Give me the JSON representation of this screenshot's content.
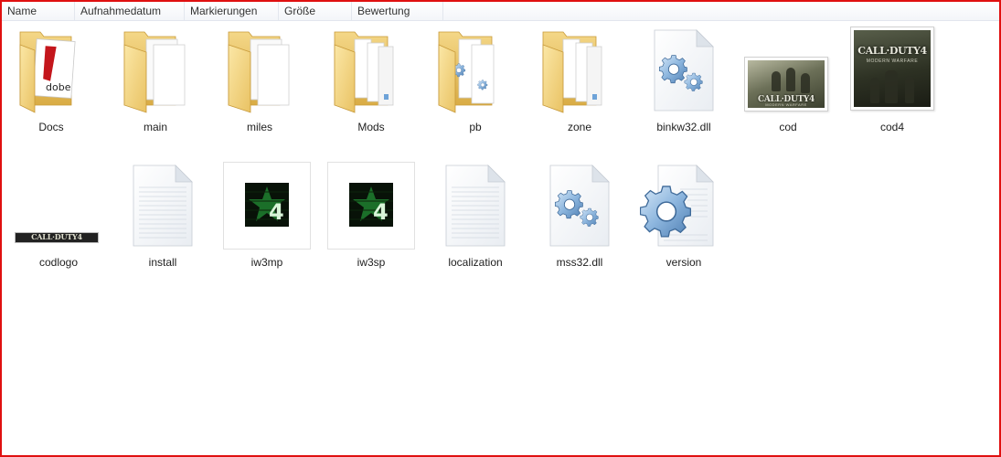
{
  "columns": {
    "name": "Name",
    "date": "Aufnahmedatum",
    "tags": "Markierungen",
    "size": "Größe",
    "rating": "Bewertung"
  },
  "items": {
    "docs": {
      "label": "Docs",
      "icon": "folder-pdf-icon"
    },
    "main": {
      "label": "main",
      "icon": "folder-documents-icon"
    },
    "miles": {
      "label": "miles",
      "icon": "folder-documents-icon"
    },
    "mods": {
      "label": "Mods",
      "icon": "folder-files-icon"
    },
    "pb": {
      "label": "pb",
      "icon": "folder-gear-icon"
    },
    "zone": {
      "label": "zone",
      "icon": "folder-files-icon"
    },
    "binkw32": {
      "label": "binkw32.dll",
      "icon": "dll-file-icon"
    },
    "cod": {
      "label": "cod",
      "icon": "image-thumbnail"
    },
    "cod4": {
      "label": "cod4",
      "icon": "image-thumbnail"
    },
    "codlogo": {
      "label": "codlogo",
      "icon": "image-thumbnail"
    },
    "install": {
      "label": "install",
      "icon": "text-file-icon"
    },
    "iw3mp": {
      "label": "iw3mp",
      "icon": "cod4-app-icon"
    },
    "iw3sp": {
      "label": "iw3sp",
      "icon": "cod4-app-icon"
    },
    "localization": {
      "label": "localization",
      "icon": "text-file-icon"
    },
    "mss32": {
      "label": "mss32.dll",
      "icon": "dll-file-icon"
    },
    "version": {
      "label": "version",
      "icon": "system-file-icon"
    }
  },
  "thumbs": {
    "docs_brand": "dobe",
    "cod_title": "CALL·DUTY4",
    "cod_sub": "MODERN WARFARE",
    "cod4_title": "CALL·DUTY4",
    "cod4_sub": "MODERN WARFARE",
    "codlogo_text": "CALL·DUTY4",
    "app_glyph": "4"
  },
  "colors": {
    "window_border": "#e01010",
    "folder": "#f1cf6b",
    "gear": "#7fa9d6"
  }
}
